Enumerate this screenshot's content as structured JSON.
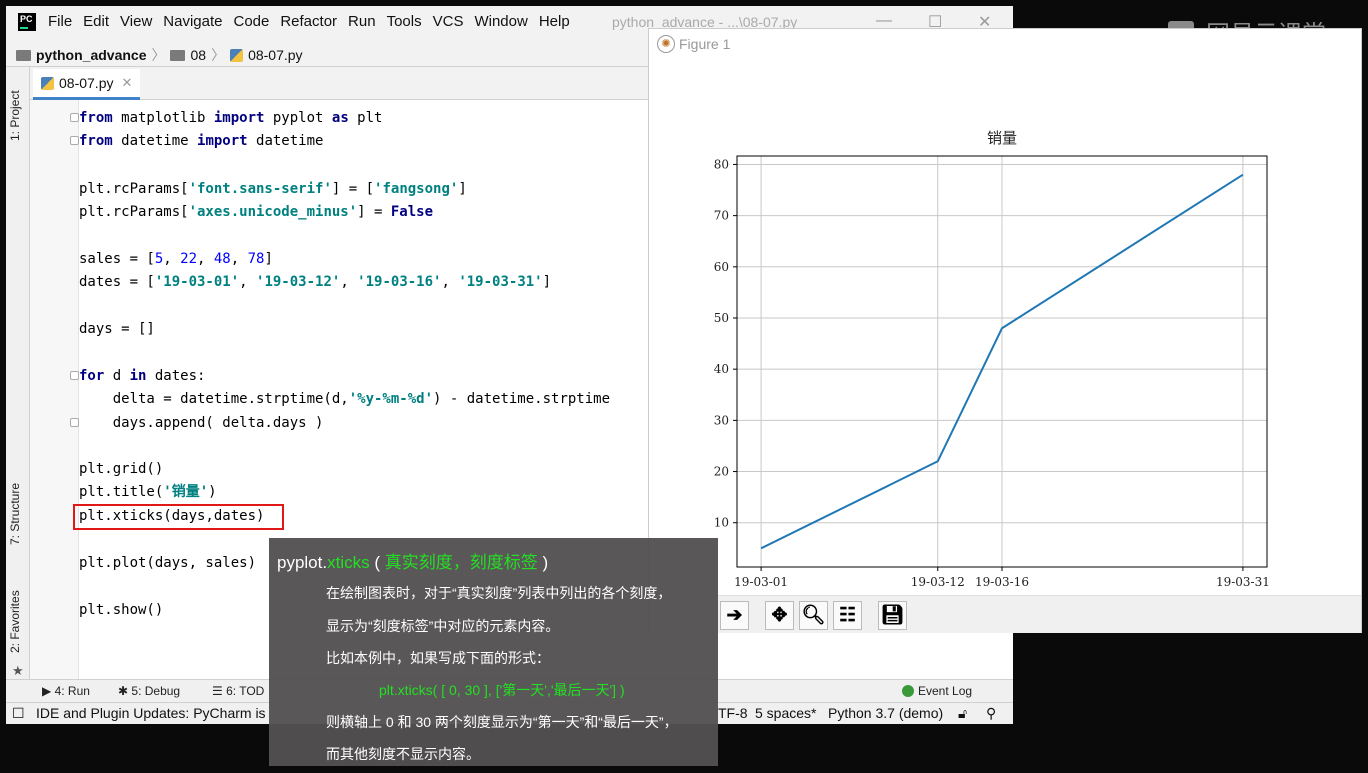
{
  "ide": {
    "menu": [
      "File",
      "Edit",
      "View",
      "Navigate",
      "Code",
      "Refactor",
      "Run",
      "Tools",
      "VCS",
      "Window",
      "Help"
    ],
    "window_title": "python_advance - ...\\08-07.py",
    "breadcrumb": [
      "python_advance",
      "08",
      "08-07.py"
    ],
    "side_tabs": {
      "project": "1: Project",
      "structure": "7: Structure",
      "favorites": "2: Favorites"
    },
    "editor_tab": "08-07.py",
    "code_lines": [
      "from matplotlib import pyplot as plt",
      "from datetime import datetime",
      "",
      "plt.rcParams['font.sans-serif'] = ['fangsong']",
      "plt.rcParams['axes.unicode_minus'] = False",
      "",
      "sales = [5, 22, 48, 78]",
      "dates = ['19-03-01', '19-03-12', '19-03-16', '19-03-31']",
      "",
      "days = []",
      "",
      "for d in dates:",
      "    delta = datetime.strptime(d,'%y-%m-%d') - datetime.strptime",
      "    days.append( delta.days )",
      "",
      "plt.grid()",
      "plt.title('销量')",
      "plt.xticks(days,dates)",
      "",
      "plt.plot(days, sales)",
      "",
      "plt.show()"
    ],
    "bottom_tabs": {
      "run": "4: Run",
      "debug": "5: Debug",
      "todo": "6: TOD",
      "event_log": "Event Log"
    },
    "status": {
      "message": "IDE and Plugin Updates: PyCharm is",
      "encoding": "TF-8",
      "indent": "5 spaces*",
      "interpreter": "Python 3.7 (demo)"
    }
  },
  "figure": {
    "window_title": "Figure 1",
    "toolbar": [
      "forward-icon",
      "pan-icon",
      "zoom-icon",
      "subplots-icon",
      "save-icon"
    ]
  },
  "chart_data": {
    "type": "line",
    "title": "销量",
    "x": [
      0,
      11,
      15,
      30
    ],
    "xtick_labels": [
      "19-03-01",
      "19-03-12",
      "19-03-16",
      "19-03-31"
    ],
    "series": [
      {
        "values": [
          5,
          22,
          48,
          78
        ]
      }
    ],
    "yticks": [
      10,
      20,
      30,
      40,
      50,
      60,
      70,
      80
    ],
    "xlim": [
      -1.5,
      31.5
    ],
    "ylim": [
      1.35,
      81.65
    ],
    "grid": true,
    "line_color": "#1f77b4"
  },
  "watermark": "网易云课堂",
  "overlay": {
    "title_prefix": "pyplot.",
    "title_func": "xticks",
    "title_open": "(",
    "title_args": "真实刻度，刻度标签",
    "title_close": ")",
    "line1": "在绘制图表时，对于“真实刻度”列表中列出的各个刻度，",
    "line2": "显示为“刻度标签”中对应的元素内容。",
    "line3": "比如本例中，如果写成下面的形式：",
    "line4": "plt.xticks( [ 0, 30 ], ['第一天','最后一天'] )",
    "line5": "则横轴上 0 和 30 两个刻度显示为“第一天”和“最后一天”，",
    "line6": "而其他刻度不显示内容。"
  }
}
